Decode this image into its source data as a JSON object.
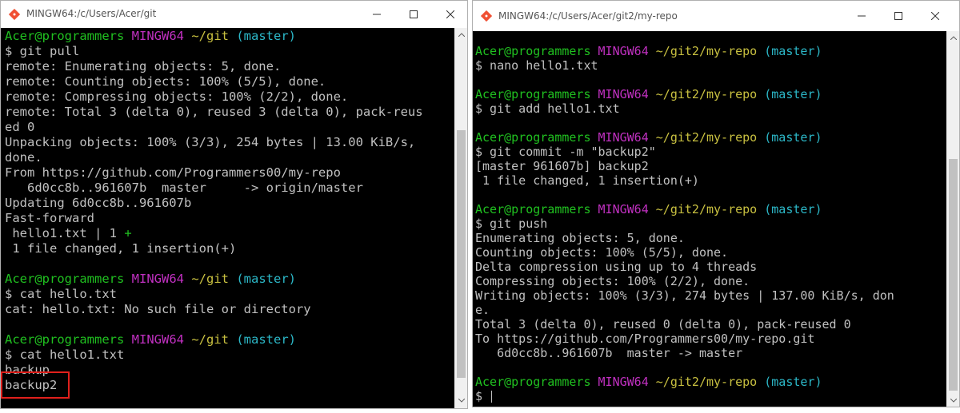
{
  "windows": [
    {
      "title": "MINGW64:/c/Users/Acer/git",
      "lines": [
        {
          "segments": [
            {
              "t": "Acer@programmers",
              "c": "green"
            },
            {
              "t": " "
            },
            {
              "t": "MINGW64",
              "c": "magenta"
            },
            {
              "t": " "
            },
            {
              "t": "~/git",
              "c": "yellow"
            },
            {
              "t": " "
            },
            {
              "t": "(master)",
              "c": "cyan"
            }
          ]
        },
        {
          "segments": [
            {
              "t": "$ git pull"
            }
          ]
        },
        {
          "segments": [
            {
              "t": "remote: Enumerating objects: 5, done."
            }
          ]
        },
        {
          "segments": [
            {
              "t": "remote: Counting objects: 100% (5/5), done."
            }
          ]
        },
        {
          "segments": [
            {
              "t": "remote: Compressing objects: 100% (2/2), done."
            }
          ]
        },
        {
          "segments": [
            {
              "t": "remote: Total 3 (delta 0), reused 3 (delta 0), pack-reus"
            }
          ]
        },
        {
          "segments": [
            {
              "t": "ed 0"
            }
          ]
        },
        {
          "segments": [
            {
              "t": "Unpacking objects: 100% (3/3), 254 bytes | 13.00 KiB/s,"
            }
          ]
        },
        {
          "segments": [
            {
              "t": "done."
            }
          ]
        },
        {
          "segments": [
            {
              "t": "From https://github.com/Programmers00/my-repo"
            }
          ]
        },
        {
          "segments": [
            {
              "t": "   6d0cc8b..961607b  master     -> origin/master"
            }
          ]
        },
        {
          "segments": [
            {
              "t": "Updating 6d0cc8b..961607b"
            }
          ]
        },
        {
          "segments": [
            {
              "t": "Fast-forward"
            }
          ]
        },
        {
          "segments": [
            {
              "t": " hello1.txt | 1 "
            },
            {
              "t": "+",
              "c": "green"
            }
          ]
        },
        {
          "segments": [
            {
              "t": " 1 file changed, 1 insertion(+)"
            }
          ]
        },
        {
          "segments": [
            {
              "t": ""
            }
          ]
        },
        {
          "segments": [
            {
              "t": "Acer@programmers",
              "c": "green"
            },
            {
              "t": " "
            },
            {
              "t": "MINGW64",
              "c": "magenta"
            },
            {
              "t": " "
            },
            {
              "t": "~/git",
              "c": "yellow"
            },
            {
              "t": " "
            },
            {
              "t": "(master)",
              "c": "cyan"
            }
          ]
        },
        {
          "segments": [
            {
              "t": "$ cat hello.txt"
            }
          ]
        },
        {
          "segments": [
            {
              "t": "cat: hello.txt: No such file or directory"
            }
          ]
        },
        {
          "segments": [
            {
              "t": ""
            }
          ]
        },
        {
          "segments": [
            {
              "t": "Acer@programmers",
              "c": "green"
            },
            {
              "t": " "
            },
            {
              "t": "MINGW64",
              "c": "magenta"
            },
            {
              "t": " "
            },
            {
              "t": "~/git",
              "c": "yellow"
            },
            {
              "t": " "
            },
            {
              "t": "(master)",
              "c": "cyan"
            }
          ]
        },
        {
          "segments": [
            {
              "t": "$ cat hello1.txt"
            }
          ]
        },
        {
          "segments": [
            {
              "t": "backup"
            }
          ]
        },
        {
          "segments": [
            {
              "t": "backup2"
            }
          ]
        }
      ]
    },
    {
      "title": "MINGW64:/c/Users/Acer/git2/my-repo",
      "lines": [
        {
          "segments": [
            {
              "t": ""
            }
          ]
        },
        {
          "segments": [
            {
              "t": "Acer@programmers",
              "c": "green"
            },
            {
              "t": " "
            },
            {
              "t": "MINGW64",
              "c": "magenta"
            },
            {
              "t": " "
            },
            {
              "t": "~/git2/my-repo",
              "c": "yellow"
            },
            {
              "t": " "
            },
            {
              "t": "(master)",
              "c": "cyan"
            }
          ]
        },
        {
          "segments": [
            {
              "t": "$ nano hello1.txt"
            }
          ]
        },
        {
          "segments": [
            {
              "t": ""
            }
          ]
        },
        {
          "segments": [
            {
              "t": "Acer@programmers",
              "c": "green"
            },
            {
              "t": " "
            },
            {
              "t": "MINGW64",
              "c": "magenta"
            },
            {
              "t": " "
            },
            {
              "t": "~/git2/my-repo",
              "c": "yellow"
            },
            {
              "t": " "
            },
            {
              "t": "(master)",
              "c": "cyan"
            }
          ]
        },
        {
          "segments": [
            {
              "t": "$ git add hello1.txt"
            }
          ]
        },
        {
          "segments": [
            {
              "t": ""
            }
          ]
        },
        {
          "segments": [
            {
              "t": "Acer@programmers",
              "c": "green"
            },
            {
              "t": " "
            },
            {
              "t": "MINGW64",
              "c": "magenta"
            },
            {
              "t": " "
            },
            {
              "t": "~/git2/my-repo",
              "c": "yellow"
            },
            {
              "t": " "
            },
            {
              "t": "(master)",
              "c": "cyan"
            }
          ]
        },
        {
          "segments": [
            {
              "t": "$ git commit -m \"backup2\""
            }
          ]
        },
        {
          "segments": [
            {
              "t": "[master 961607b] backup2"
            }
          ]
        },
        {
          "segments": [
            {
              "t": " 1 file changed, 1 insertion(+)"
            }
          ]
        },
        {
          "segments": [
            {
              "t": ""
            }
          ]
        },
        {
          "segments": [
            {
              "t": "Acer@programmers",
              "c": "green"
            },
            {
              "t": " "
            },
            {
              "t": "MINGW64",
              "c": "magenta"
            },
            {
              "t": " "
            },
            {
              "t": "~/git2/my-repo",
              "c": "yellow"
            },
            {
              "t": " "
            },
            {
              "t": "(master)",
              "c": "cyan"
            }
          ]
        },
        {
          "segments": [
            {
              "t": "$ git push"
            }
          ]
        },
        {
          "segments": [
            {
              "t": "Enumerating objects: 5, done."
            }
          ]
        },
        {
          "segments": [
            {
              "t": "Counting objects: 100% (5/5), done."
            }
          ]
        },
        {
          "segments": [
            {
              "t": "Delta compression using up to 4 threads"
            }
          ]
        },
        {
          "segments": [
            {
              "t": "Compressing objects: 100% (2/2), done."
            }
          ]
        },
        {
          "segments": [
            {
              "t": "Writing objects: 100% (3/3), 274 bytes | 137.00 KiB/s, don"
            }
          ]
        },
        {
          "segments": [
            {
              "t": "e."
            }
          ]
        },
        {
          "segments": [
            {
              "t": "Total 3 (delta 0), reused 0 (delta 0), pack-reused 0"
            }
          ]
        },
        {
          "segments": [
            {
              "t": "To https://github.com/Programmers00/my-repo.git"
            }
          ]
        },
        {
          "segments": [
            {
              "t": "   6d0cc8b..961607b  master -> master"
            }
          ]
        },
        {
          "segments": [
            {
              "t": ""
            }
          ]
        },
        {
          "segments": [
            {
              "t": "Acer@programmers",
              "c": "green"
            },
            {
              "t": " "
            },
            {
              "t": "MINGW64",
              "c": "magenta"
            },
            {
              "t": " "
            },
            {
              "t": "~/git2/my-repo",
              "c": "yellow"
            },
            {
              "t": " "
            },
            {
              "t": "(master)",
              "c": "cyan"
            }
          ]
        },
        {
          "segments": [
            {
              "t": "$ "
            }
          ],
          "cursor": true
        }
      ]
    }
  ],
  "icons": {
    "app": "git-bash-icon",
    "minimize": "minimize-icon",
    "maximize": "maximize-icon",
    "close": "close-icon"
  },
  "colors": {
    "green": "#20c020",
    "magenta": "#c030c0",
    "yellow": "#c8c040",
    "cyan": "#2cb8c8",
    "text": "#c0c0c0",
    "highlight": "#e0201c"
  }
}
